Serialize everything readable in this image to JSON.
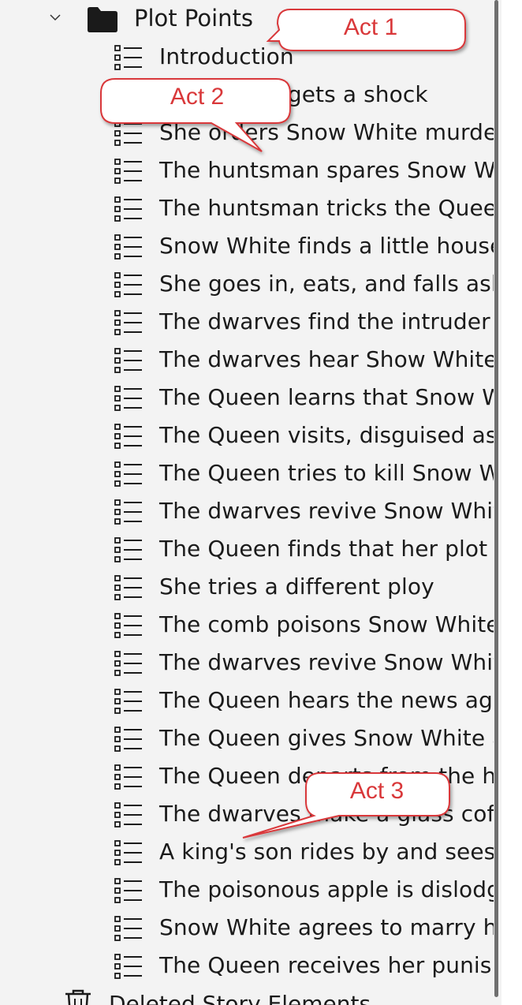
{
  "tree": {
    "folder": {
      "label": "Plot Points",
      "icon": "folder-icon",
      "expanded": true
    },
    "items": [
      "Introduction",
      "The Queen gets a shock",
      "She orders Snow White murdered",
      "The huntsman spares Snow White",
      "The huntsman tricks the Queen",
      "Snow White finds a little house",
      "She goes in, eats, and falls asleep",
      "The dwarves find the intruder",
      "The dwarves hear Show White's story",
      "The Queen learns that Snow White lives",
      "The Queen visits, disguised as a peddler",
      "The Queen tries to kill Snow White",
      "The dwarves revive Snow White",
      "The Queen finds that her plot failed",
      "She tries a different ploy",
      "The comb poisons Snow White",
      "The dwarves revive Snow White again",
      "The Queen hears the news again",
      "The Queen gives Snow White a poisoned apple",
      "The Queen departs from the house",
      "The dwarves make a glass coffin",
      "A king's son rides by and sees Snow White",
      "The poisonous apple is dislodged",
      "Snow White agrees to marry him",
      "The Queen receives her punishment"
    ],
    "trash": {
      "label": "Deleted Story Elements",
      "icon": "trash-icon"
    }
  },
  "callouts": {
    "act1": "Act 1",
    "act2": "Act 2",
    "act3": "Act 3",
    "color": "#d9383a"
  }
}
